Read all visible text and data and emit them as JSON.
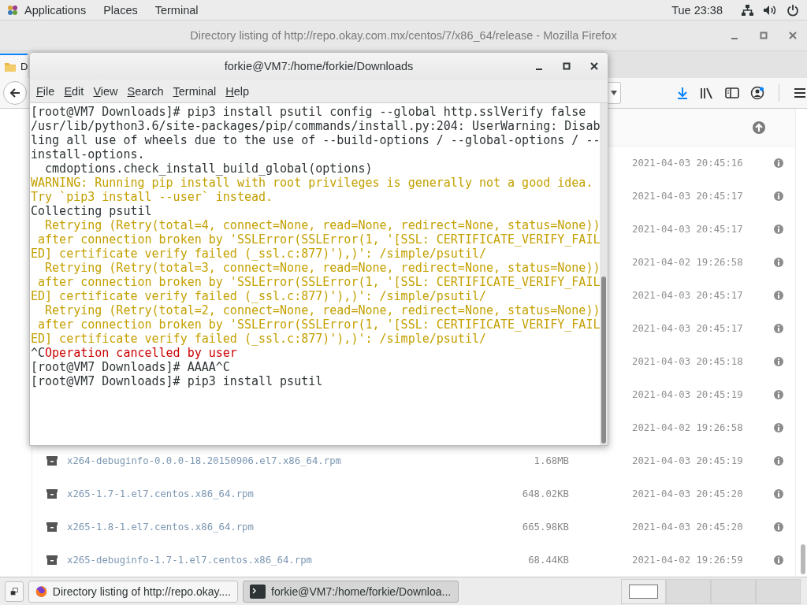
{
  "top_bar": {
    "menus": [
      "Applications",
      "Places",
      "Terminal"
    ],
    "clock": "Tue 23:38"
  },
  "firefox": {
    "title": "Directory listing of http://repo.okay.com.mx/centos/7/x86_64/release - Mozilla Firefox",
    "tab": {
      "label": "D",
      "selected": true
    },
    "rows": [
      {
        "date": "2021-04-03 20:45:16"
      },
      {
        "date": "2021-04-03 20:45:17"
      },
      {
        "date": "2021-04-03 20:45:17"
      },
      {
        "date": "2021-04-02 19:26:58"
      },
      {
        "date": "2021-04-03 20:45:17"
      },
      {
        "date": "2021-04-03 20:45:17"
      },
      {
        "date": "2021-04-03 20:45:18"
      },
      {
        "date": "2021-04-03 20:45:19"
      },
      {
        "date": "2021-04-02 19:26:58"
      },
      {
        "name": "x264-debuginfo-0.0.0-18.20150906.el7.x86_64.rpm",
        "size": "1.68MB",
        "date": "2021-04-03 20:45:19"
      },
      {
        "name": "x265-1.7-1.el7.centos.x86_64.rpm",
        "size": "648.02KB",
        "date": "2021-04-03 20:45:20"
      },
      {
        "name": "x265-1.8-1.el7.centos.x86_64.rpm",
        "size": "665.98KB",
        "date": "2021-04-03 20:45:20"
      },
      {
        "name": "x265-debuginfo-1.7-1.el7.centos.x86_64.rpm",
        "size": "68.44KB",
        "date": "2021-04-02 19:26:59"
      }
    ]
  },
  "terminal": {
    "title": "forkie@VM7:/home/forkie/Downloads",
    "menus": [
      "File",
      "Edit",
      "View",
      "Search",
      "Terminal",
      "Help"
    ],
    "lines": [
      [
        {
          "text": "[root@VM7 Downloads]# pip3 install psutil config --global http.sslVerify false",
          "kind": "normal"
        }
      ],
      [
        {
          "text": "/usr/lib/python3.6/site-packages/pip/commands/install.py:204: UserWarning: Disab",
          "kind": "normal"
        }
      ],
      [
        {
          "text": "ling all use of wheels due to the use of --build-options / --global-options / --",
          "kind": "normal"
        }
      ],
      [
        {
          "text": "install-options.",
          "kind": "normal"
        }
      ],
      [
        {
          "text": "  cmdoptions.check_install_build_global(options)",
          "kind": "normal"
        }
      ],
      [
        {
          "text": "WARNING: Running pip install with root privileges is generally not a good idea.",
          "kind": "warning"
        }
      ],
      [
        {
          "text": "Try `pip3 install --user` instead.",
          "kind": "warning"
        }
      ],
      [
        {
          "text": "Collecting psutil",
          "kind": "normal"
        }
      ],
      [
        {
          "text": "  Retrying (Retry(total=4, connect=None, read=None, redirect=None, status=None))",
          "kind": "warning"
        }
      ],
      [
        {
          "text": " after connection broken by 'SSLError(SSLError(1, '[SSL: CERTIFICATE_VERIFY_FAIL",
          "kind": "warning"
        }
      ],
      [
        {
          "text": "ED] certificate verify failed (_ssl.c:877)'),)': /simple/psutil/",
          "kind": "warning"
        }
      ],
      [
        {
          "text": "  Retrying (Retry(total=3, connect=None, read=None, redirect=None, status=None))",
          "kind": "warning"
        }
      ],
      [
        {
          "text": " after connection broken by 'SSLError(SSLError(1, '[SSL: CERTIFICATE_VERIFY_FAIL",
          "kind": "warning"
        }
      ],
      [
        {
          "text": "ED] certificate verify failed (_ssl.c:877)'),)': /simple/psutil/",
          "kind": "warning"
        }
      ],
      [
        {
          "text": "  Retrying (Retry(total=2, connect=None, read=None, redirect=None, status=None))",
          "kind": "warning"
        }
      ],
      [
        {
          "text": " after connection broken by 'SSLError(SSLError(1, '[SSL: CERTIFICATE_VERIFY_FAIL",
          "kind": "warning"
        }
      ],
      [
        {
          "text": "ED] certificate verify failed (_ssl.c:877)'),)': /simple/psutil/",
          "kind": "warning"
        }
      ],
      [
        {
          "text": "^C",
          "kind": "normal"
        },
        {
          "text": "Operation cancelled by user",
          "kind": "error"
        }
      ],
      [
        {
          "text": "[root@VM7 Downloads]# AAAA^C",
          "kind": "normal"
        }
      ],
      [
        {
          "text": "[root@VM7 Downloads]# pip3 install psutil",
          "kind": "normal"
        }
      ]
    ]
  },
  "taskbar": {
    "tasks": [
      {
        "label": "Directory listing of http://repo.okay....",
        "selected": false,
        "kind": "browser"
      },
      {
        "label": "forkie@VM7:/home/forkie/Downloa...",
        "selected": true,
        "kind": "terminal"
      }
    ],
    "workspaces": [
      {
        "selected": true
      },
      {
        "selected": false
      },
      {
        "selected": false
      },
      {
        "selected": false
      }
    ]
  }
}
